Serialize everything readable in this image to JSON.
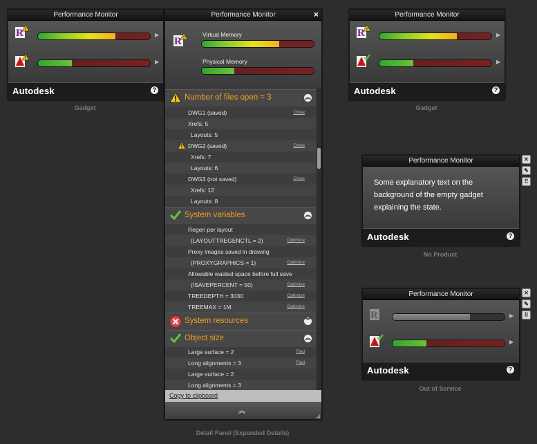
{
  "gadget_left": {
    "title": "Performance Monitor",
    "brand": "Autodesk",
    "help": "?",
    "caption": "Gadget",
    "products": [
      {
        "icon": "revit-warning-icon",
        "progress": 0.69
      },
      {
        "icon": "autocad-warning-icon",
        "progress": 0.3
      }
    ]
  },
  "gadget_right": {
    "title": "Performance Monitor",
    "brand": "Autodesk",
    "help": "?",
    "caption": "Gadget",
    "products": [
      {
        "icon": "revit-warning-icon",
        "progress": 0.69
      },
      {
        "icon": "autocad-check-icon",
        "progress": 0.3
      }
    ]
  },
  "detail_panel": {
    "title": "Performance Monitor",
    "close": "×",
    "caption": "Detail Panel (Expanded Details)",
    "virtual_memory_label": "Virtual Memory",
    "virtual_memory_progress": 0.69,
    "physical_memory_label": "Physical Memory",
    "physical_memory_progress": 0.29,
    "files_section": {
      "title": "Number of files open = 3",
      "rows": [
        {
          "text": "DWG1 (saved)",
          "link": "Close"
        },
        {
          "text": "Xrefs: 5",
          "link": ""
        },
        {
          "text": "Layouts: 5",
          "link": ""
        },
        {
          "text": "DWG2 (saved)",
          "link": "Close",
          "warning": true
        },
        {
          "text": "Xrefs: 7",
          "link": ""
        },
        {
          "text": "Layouts: 6",
          "link": ""
        },
        {
          "text": "DWG3 (not saved)",
          "link": "Close"
        },
        {
          "text": "Xrefs: 12",
          "link": ""
        },
        {
          "text": "Layouts: 8",
          "link": ""
        }
      ]
    },
    "sysvar_section": {
      "title": "System variables",
      "rows": [
        {
          "text": "Regen per layout",
          "link": ""
        },
        {
          "text": "(LAYOUTTREGENCTL = 2)",
          "link": "Optimize"
        },
        {
          "text": "Proxy images saved in drawing",
          "link": ""
        },
        {
          "text": "(PROXYGRAPHICS = 1)",
          "link": "Optimize"
        },
        {
          "text": "Allowable wasted space before full save",
          "link": ""
        },
        {
          "text": "(ISAVEPERCENT = 50)",
          "link": "Optimize"
        },
        {
          "text": "TREEDEPTH = 3030",
          "link": "Optimize"
        },
        {
          "text": "TREEMAX = 1M",
          "link": "Optimize"
        }
      ]
    },
    "resources_section": {
      "title": "System resources"
    },
    "objsize_section": {
      "title": "Object size",
      "rows": [
        {
          "text": "Large surface = 2",
          "link": "Find"
        },
        {
          "text": "Long alignments = 3",
          "link": "Find"
        },
        {
          "text": "Large surface = 2",
          "link": ""
        },
        {
          "text": "Long alignments = 3",
          "link": ""
        }
      ]
    },
    "copy_link": "Copy to clipboard"
  },
  "no_product": {
    "title": "Performance Monitor",
    "message": "Some explanatory text on the background of the empty gadget explaining the state.",
    "brand": "Autodesk",
    "help": "?",
    "caption": "No Product"
  },
  "out_of_service": {
    "title": "Performance Monitor",
    "brand": "Autodesk",
    "help": "?",
    "caption": "Out of Service",
    "products": [
      {
        "icon": "revit-disabled-icon",
        "progress": 0.69
      },
      {
        "icon": "autocad-check-icon",
        "progress": 0.3
      }
    ]
  },
  "colors": {
    "accent_orange": "#f0a020",
    "bar_red": "#7a2020",
    "bar_green": "#2ea82e"
  }
}
